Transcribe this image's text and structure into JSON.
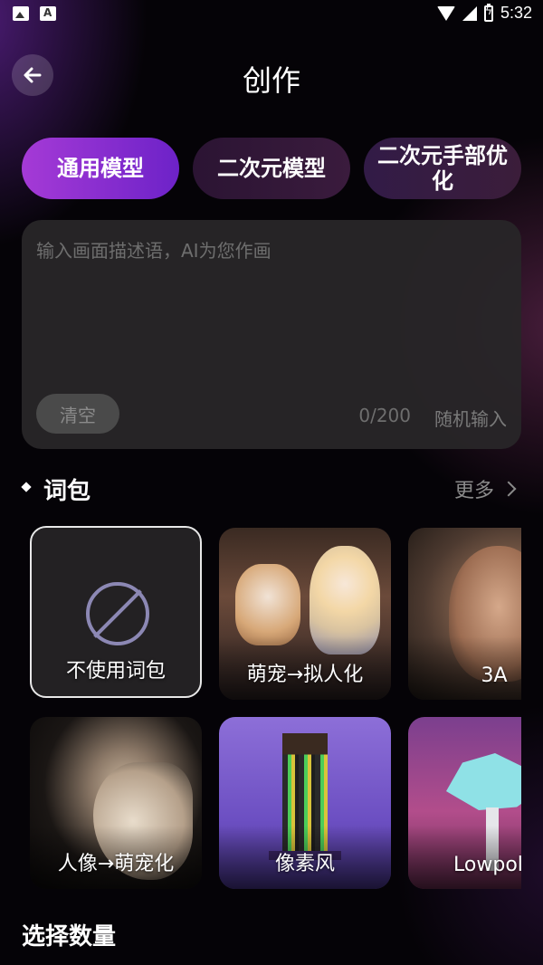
{
  "status_bar": {
    "time": "5:32",
    "left_icons": [
      "image-notification-icon",
      "text-notification-icon"
    ],
    "right_icons": [
      "wifi-icon",
      "signal-icon",
      "battery-charging-icon"
    ]
  },
  "header": {
    "title": "创作",
    "back_icon": "arrow-left-icon"
  },
  "model_tabs": [
    {
      "label": "通用模型",
      "selected": true
    },
    {
      "label": "二次元模型",
      "selected": false
    },
    {
      "label": "二次元手部优化",
      "selected": false
    }
  ],
  "prompt": {
    "placeholder": "输入画面描述语，AI为您作画",
    "value": "",
    "clear_label": "清空",
    "char_count": "0/200",
    "random_label": "随机输入"
  },
  "word_pack": {
    "title": "词包",
    "more_label": "更多",
    "cards": [
      {
        "label": "不使用词包",
        "selected": true,
        "icon": "no-entry-icon"
      },
      {
        "label": "萌宠→拟人化",
        "selected": false
      },
      {
        "label": "3A",
        "selected": false
      },
      {
        "label": "人像→萌宠化",
        "selected": false
      },
      {
        "label": "像素风",
        "selected": false
      },
      {
        "label": "Lowpoly",
        "selected": false
      }
    ]
  },
  "quantity": {
    "title": "选择数量"
  },
  "colors": {
    "accent_gradient_start": "#a53ad6",
    "accent_gradient_end": "#6d22c8",
    "background": "#050307"
  }
}
